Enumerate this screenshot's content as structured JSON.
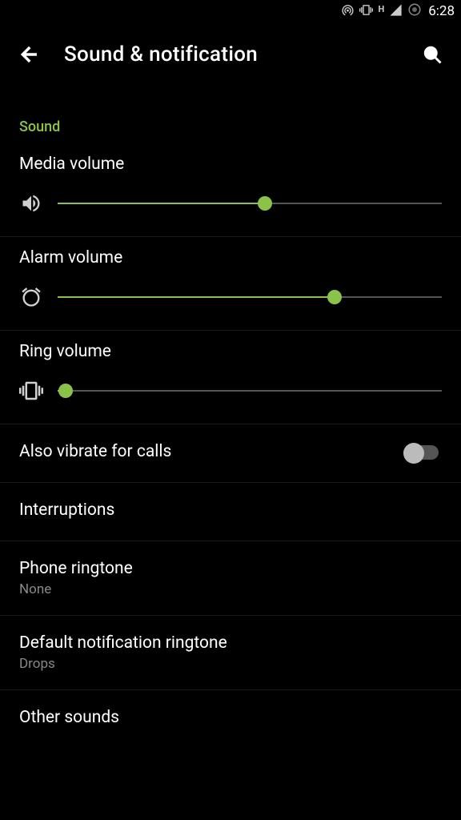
{
  "status_bar": {
    "time": "6:28",
    "network_letter": "H"
  },
  "app_bar": {
    "title": "Sound & notification"
  },
  "section": {
    "sound_header": "Sound"
  },
  "sliders": {
    "media": {
      "label": "Media volume",
      "value": 54
    },
    "alarm": {
      "label": "Alarm volume",
      "value": 72
    },
    "ring": {
      "label": "Ring volume",
      "value": 2
    }
  },
  "settings": {
    "vibrate_calls": {
      "label": "Also vibrate for calls",
      "enabled": false
    },
    "interruptions": {
      "label": "Interruptions"
    },
    "phone_ringtone": {
      "label": "Phone ringtone",
      "value": "None"
    },
    "notif_ringtone": {
      "label": "Default notification ringtone",
      "value": "Drops"
    },
    "other_sounds": {
      "label": "Other sounds"
    }
  },
  "colors": {
    "accent": "#8BC34A"
  }
}
